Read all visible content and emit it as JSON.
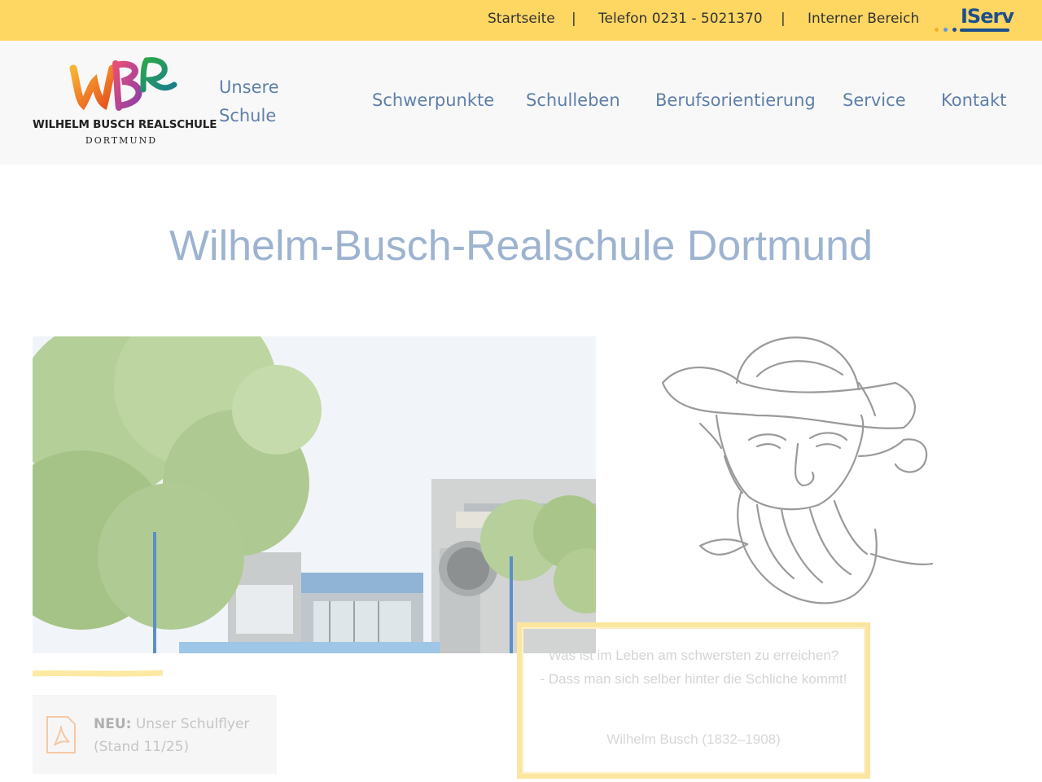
{
  "topbar": {
    "startseite": "Startseite",
    "separator": "|",
    "telefon": "Telefon 0231 - 5021370",
    "intern": "Interner Bereich",
    "iserv": "IServ",
    "bg_color": "#fed763"
  },
  "logo": {
    "mark": "WBR",
    "name": "WILHELM BUSCH REALSCHULE",
    "city": "DORTMUND"
  },
  "nav": {
    "items": [
      "Unsere Schule",
      "Schwerpunkte",
      "Schulleben",
      "Berufsorientierung",
      "Service",
      "Kontakt"
    ],
    "color": "#5f7fa9"
  },
  "main": {
    "title": "Wilhelm-Busch-Realschule Dortmund",
    "flyer_bold": "NEU:",
    "flyer_text": "Unser Schulflyer (Stand 11/25)",
    "flyer_icon": "pdf-icon",
    "quote_line1": "Was ist im Leben am schwersten zu erreichen?",
    "quote_line2": "- Dass man sich selber hinter die Schliche kommt!",
    "quote_author": "Wilhelm Busch (1832–1908)"
  }
}
